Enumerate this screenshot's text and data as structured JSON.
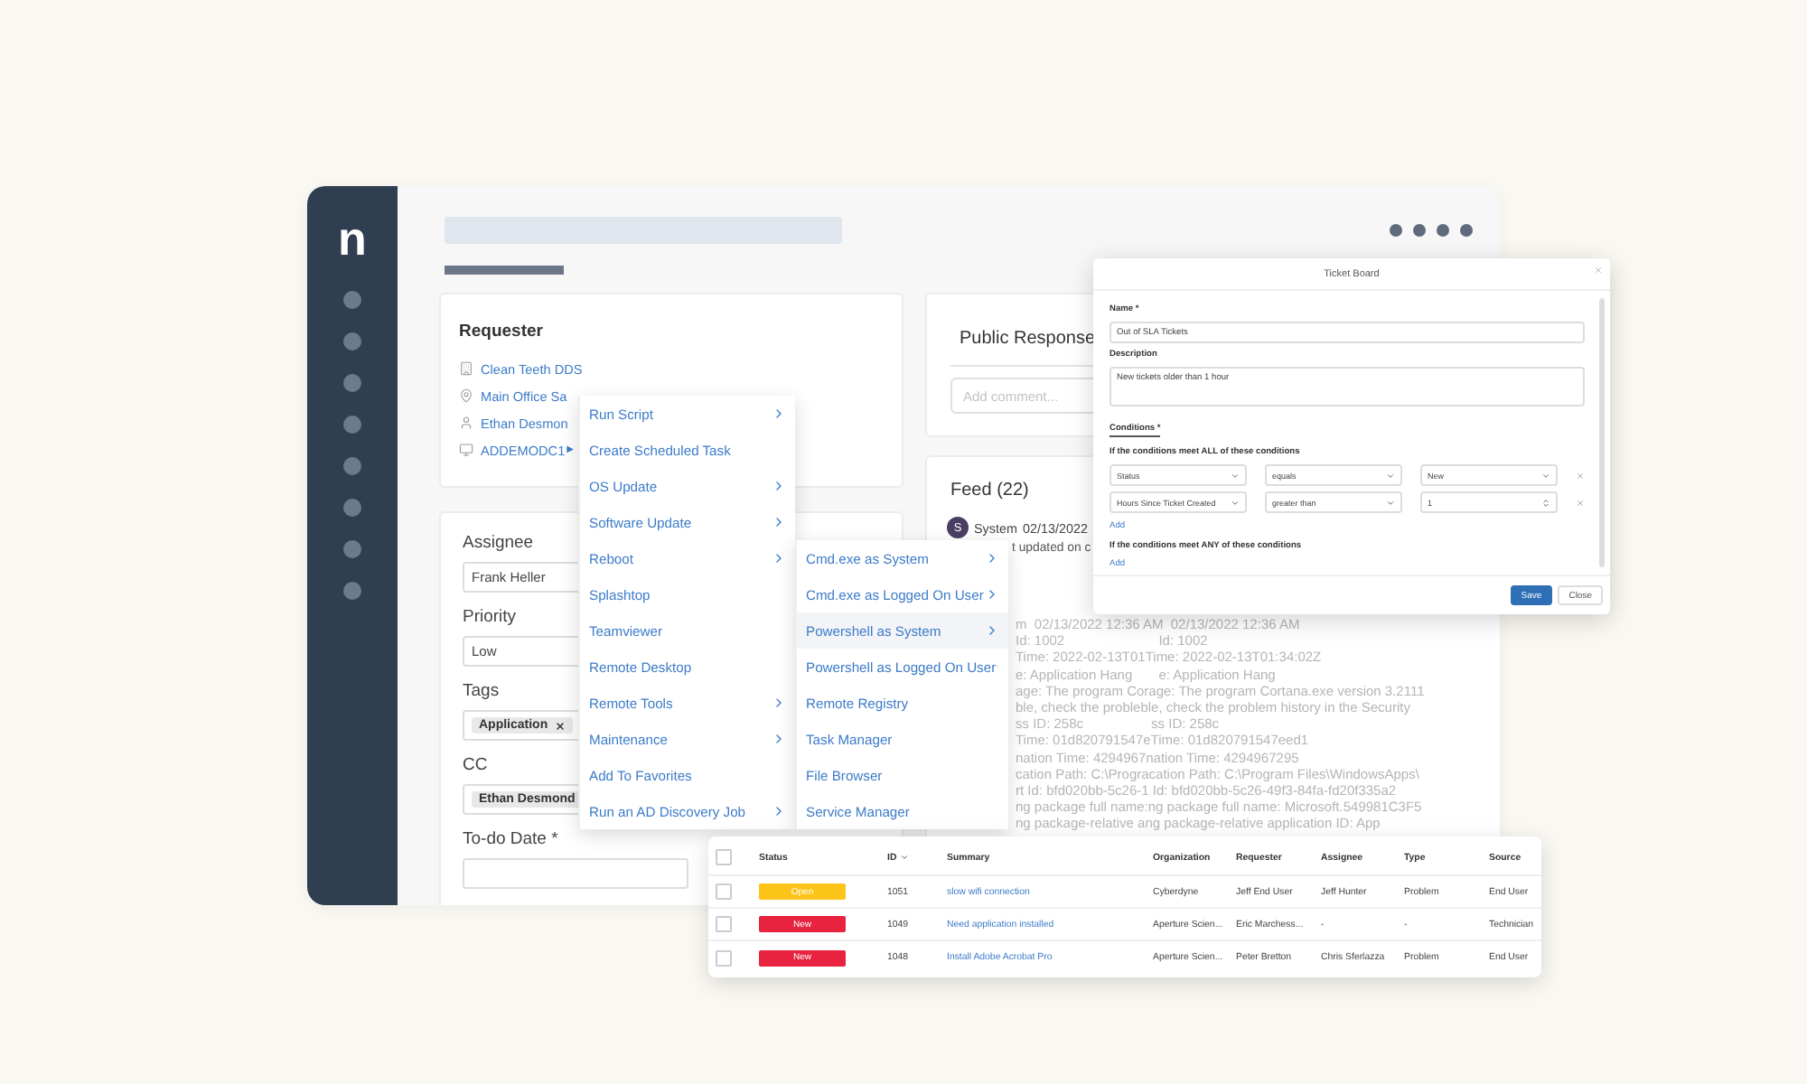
{
  "app": {
    "logo": "n"
  },
  "requester": {
    "title": "Requester",
    "items": [
      {
        "kind": "building",
        "text": "Clean Teeth DDS"
      },
      {
        "kind": "location",
        "text": "Main Office Sa"
      },
      {
        "kind": "person",
        "text": "Ethan Desmon"
      },
      {
        "kind": "computer",
        "text": "ADDEMODC1",
        "arrow": "▶"
      }
    ]
  },
  "form": {
    "fields": [
      {
        "kind": "text",
        "label": "Assignee",
        "value": "Frank Heller"
      },
      {
        "kind": "text",
        "label": "Priority",
        "value": "Low"
      },
      {
        "kind": "chips",
        "label": "Tags",
        "chips": [
          "Application"
        ]
      },
      {
        "kind": "chips",
        "label": "CC",
        "chips": [
          "Ethan Desmond"
        ]
      },
      {
        "kind": "text",
        "label": "To-do Date *"
      }
    ]
  },
  "public_response": {
    "title": "Public Response",
    "placeholder": "Add comment..."
  },
  "feed": {
    "title": "Feed (22)",
    "avatar": "S",
    "author": "System",
    "date": "02/13/2022",
    "message": "t updated on c",
    "log": [
      "m  02/13/2022 12:36 AM  02/13/2022 12:36 AM",
      "Id: 1002                         Id: 1002",
      "Time: 2022-02-13T01Time: 2022-02-13T01:34:02Z",
      "e: Application Hang       e: Application Hang",
      "age: The program Corage: The program Cortana.exe version 3.2111",
      "ble, check the probleble, check the problem history in the Security",
      "ss ID: 258c                  ss ID: 258c",
      "Time: 01d820791547eTime: 01d820791547eed1",
      "nation Time: 4294967nation Time: 4294967295",
      "cation Path: C:\\Progracation Path: C:\\Program Files\\WindowsApps\\",
      "rt Id: bfd020bb-5c26-1 Id: bfd020bb-5c26-49f3-84fa-fd20f335a2",
      "ng package full name:ng package full name: Microsoft.549981C3F5",
      "ng package-relative ang package-relative application ID: App"
    ]
  },
  "context_menu": {
    "items": [
      {
        "label": "Run Script",
        "submenu": true
      },
      {
        "label": "Create Scheduled Task",
        "submenu": false
      },
      {
        "label": "OS Update",
        "submenu": true
      },
      {
        "label": "Software Update",
        "submenu": true
      },
      {
        "label": "Reboot",
        "submenu": true
      },
      {
        "label": "Splashtop",
        "submenu": false
      },
      {
        "label": "Teamviewer",
        "submenu": false
      },
      {
        "label": "Remote Desktop",
        "submenu": false
      },
      {
        "label": "Remote Tools",
        "submenu": true
      },
      {
        "label": "Maintenance",
        "submenu": true
      },
      {
        "label": "Add To Favorites",
        "submenu": false
      },
      {
        "label": "Run an AD Discovery Job",
        "submenu": true
      }
    ]
  },
  "submenu": {
    "items": [
      {
        "label": "Cmd.exe as System",
        "submenu": true,
        "selected": false
      },
      {
        "label": "Cmd.exe as Logged On User",
        "submenu": true,
        "selected": false
      },
      {
        "label": "Powershell as System",
        "submenu": true,
        "selected": true
      },
      {
        "label": "Powershell as Logged On User",
        "submenu": true,
        "selected": false
      },
      {
        "label": "Remote Registry",
        "submenu": false,
        "selected": false
      },
      {
        "label": "Task Manager",
        "submenu": false,
        "selected": false
      },
      {
        "label": "File Browser",
        "submenu": false,
        "selected": false
      },
      {
        "label": "Service Manager",
        "submenu": false,
        "selected": false
      }
    ]
  },
  "dialog": {
    "title": "Ticket Board",
    "name_label": "Name *",
    "name_value": "Out of SLA Tickets",
    "description_label": "Description",
    "description_value": "New tickets older than 1 hour",
    "conditions_label": "Conditions *",
    "all_label": "If the conditions meet ALL of these conditions",
    "all_conditions": [
      {
        "field": "Status",
        "operator": "equals",
        "value": "New",
        "kind": "select"
      },
      {
        "field": "Hours Since Ticket Created",
        "operator": "greater than",
        "value": "1",
        "kind": "number"
      }
    ],
    "all_add": "Add",
    "any_label": "If the conditions meet ANY of these conditions",
    "any_add": "Add",
    "buttons": [
      {
        "label": "Save",
        "kind": "primary"
      },
      {
        "label": "Close",
        "kind": "secondary"
      }
    ]
  },
  "tickets": {
    "all_checked": false,
    "columns": [
      {
        "label": "Status",
        "sorted": false
      },
      {
        "label": "ID",
        "sorted": true
      },
      {
        "label": "Summary",
        "sorted": false
      },
      {
        "label": "Organization",
        "sorted": false
      },
      {
        "label": "Requester",
        "sorted": false
      },
      {
        "label": "Assignee",
        "sorted": false
      },
      {
        "label": "Type",
        "sorted": false
      },
      {
        "label": "Source",
        "sorted": false
      }
    ],
    "rows": [
      {
        "checked": false,
        "status": "Open",
        "color": "#fcc419",
        "id": "1051",
        "summary": "slow wifi connection",
        "organization": "Cyberdyne",
        "requester": "Jeff End User",
        "assignee": "Jeff Hunter",
        "type": "Problem",
        "source": "End User"
      },
      {
        "checked": false,
        "status": "New",
        "color": "#e8233f",
        "id": "1049",
        "summary": "Need application installed",
        "organization": "Aperture Scien...",
        "requester": "Eric Marchess...",
        "assignee": "-",
        "type": "-",
        "source": "Technician"
      },
      {
        "checked": false,
        "status": "New",
        "color": "#e8233f",
        "id": "1048",
        "summary": "Install Adobe Acrobat Pro",
        "organization": "Aperture Scien...",
        "requester": "Peter Bretton",
        "assignee": "Chris Sferlazza",
        "type": "Problem",
        "source": "End User"
      }
    ]
  }
}
